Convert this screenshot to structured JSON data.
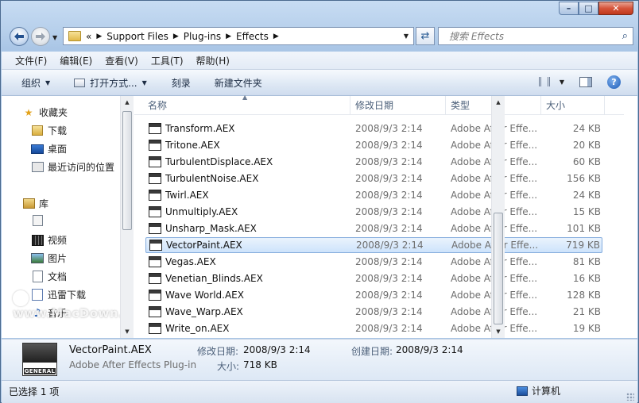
{
  "window": {
    "caption_buttons": {
      "minimize": "–",
      "maximize": "□",
      "close": "✕"
    }
  },
  "address_bar": {
    "overflow_marker": "«",
    "crumbs": [
      "Support Files",
      "Plug-ins",
      "Effects"
    ],
    "search_placeholder": "搜索 Effects"
  },
  "menu": [
    "文件(F)",
    "编辑(E)",
    "查看(V)",
    "工具(T)",
    "帮助(H)"
  ],
  "toolbar": {
    "organize": "组织",
    "open_with": "打开方式...",
    "burn": "刻录",
    "new_folder": "新建文件夹",
    "help": "?"
  },
  "nav": {
    "favorites": "收藏夹",
    "downloads": "下载",
    "desktop": "桌面",
    "recent": "最近访问的位置",
    "libraries": "库",
    "videos": "视频",
    "pictures": "图片",
    "documents": "文档",
    "thunder": "迅雷下载",
    "music": "音乐"
  },
  "columns": {
    "name": "名称",
    "date": "修改日期",
    "type": "类型",
    "size": "大小"
  },
  "files": [
    {
      "name": "Transform.AEX",
      "date": "2008/9/3 2:14",
      "type": "Adobe After Effe...",
      "size": "24 KB"
    },
    {
      "name": "Tritone.AEX",
      "date": "2008/9/3 2:14",
      "type": "Adobe After Effe...",
      "size": "20 KB"
    },
    {
      "name": "TurbulentDisplace.AEX",
      "date": "2008/9/3 2:14",
      "type": "Adobe After Effe...",
      "size": "60 KB"
    },
    {
      "name": "TurbulentNoise.AEX",
      "date": "2008/9/3 2:14",
      "type": "Adobe After Effe...",
      "size": "156 KB"
    },
    {
      "name": "Twirl.AEX",
      "date": "2008/9/3 2:14",
      "type": "Adobe After Effe...",
      "size": "24 KB"
    },
    {
      "name": "Unmultiply.AEX",
      "date": "2008/9/3 2:14",
      "type": "Adobe After Effe...",
      "size": "15 KB"
    },
    {
      "name": "Unsharp_Mask.AEX",
      "date": "2008/9/3 2:14",
      "type": "Adobe After Effe...",
      "size": "101 KB"
    },
    {
      "name": "VectorPaint.AEX",
      "date": "2008/9/3 2:14",
      "type": "Adobe After Effe...",
      "size": "719 KB"
    },
    {
      "name": "Vegas.AEX",
      "date": "2008/9/3 2:14",
      "type": "Adobe After Effe...",
      "size": "81 KB"
    },
    {
      "name": "Venetian_Blinds.AEX",
      "date": "2008/9/3 2:14",
      "type": "Adobe After Effe...",
      "size": "16 KB"
    },
    {
      "name": "Wave World.AEX",
      "date": "2008/9/3 2:14",
      "type": "Adobe After Effe...",
      "size": "128 KB"
    },
    {
      "name": "Wave_Warp.AEX",
      "date": "2008/9/3 2:14",
      "type": "Adobe After Effe...",
      "size": "21 KB"
    },
    {
      "name": "Write_on.AEX",
      "date": "2008/9/3 2:14",
      "type": "Adobe After Effe...",
      "size": "19 KB"
    }
  ],
  "selected_index": 7,
  "details": {
    "name": "VectorPaint.AEX",
    "type": "Adobe After Effects Plug-in",
    "icon_label": "GENERAL",
    "modified_label": "修改日期:",
    "modified_value": "2008/9/3 2:14",
    "created_label": "创建日期:",
    "created_value": "2008/9/3 2:14",
    "size_label": "大小:",
    "size_value": "718 KB"
  },
  "status": {
    "selected": "已选择 1 项",
    "location": "计算机"
  },
  "watermark": "www.MacDown.com",
  "colors": {
    "selection_border": "#84acdd",
    "selection_fill": "#cde3fb",
    "frame": "#b6cfeb"
  }
}
